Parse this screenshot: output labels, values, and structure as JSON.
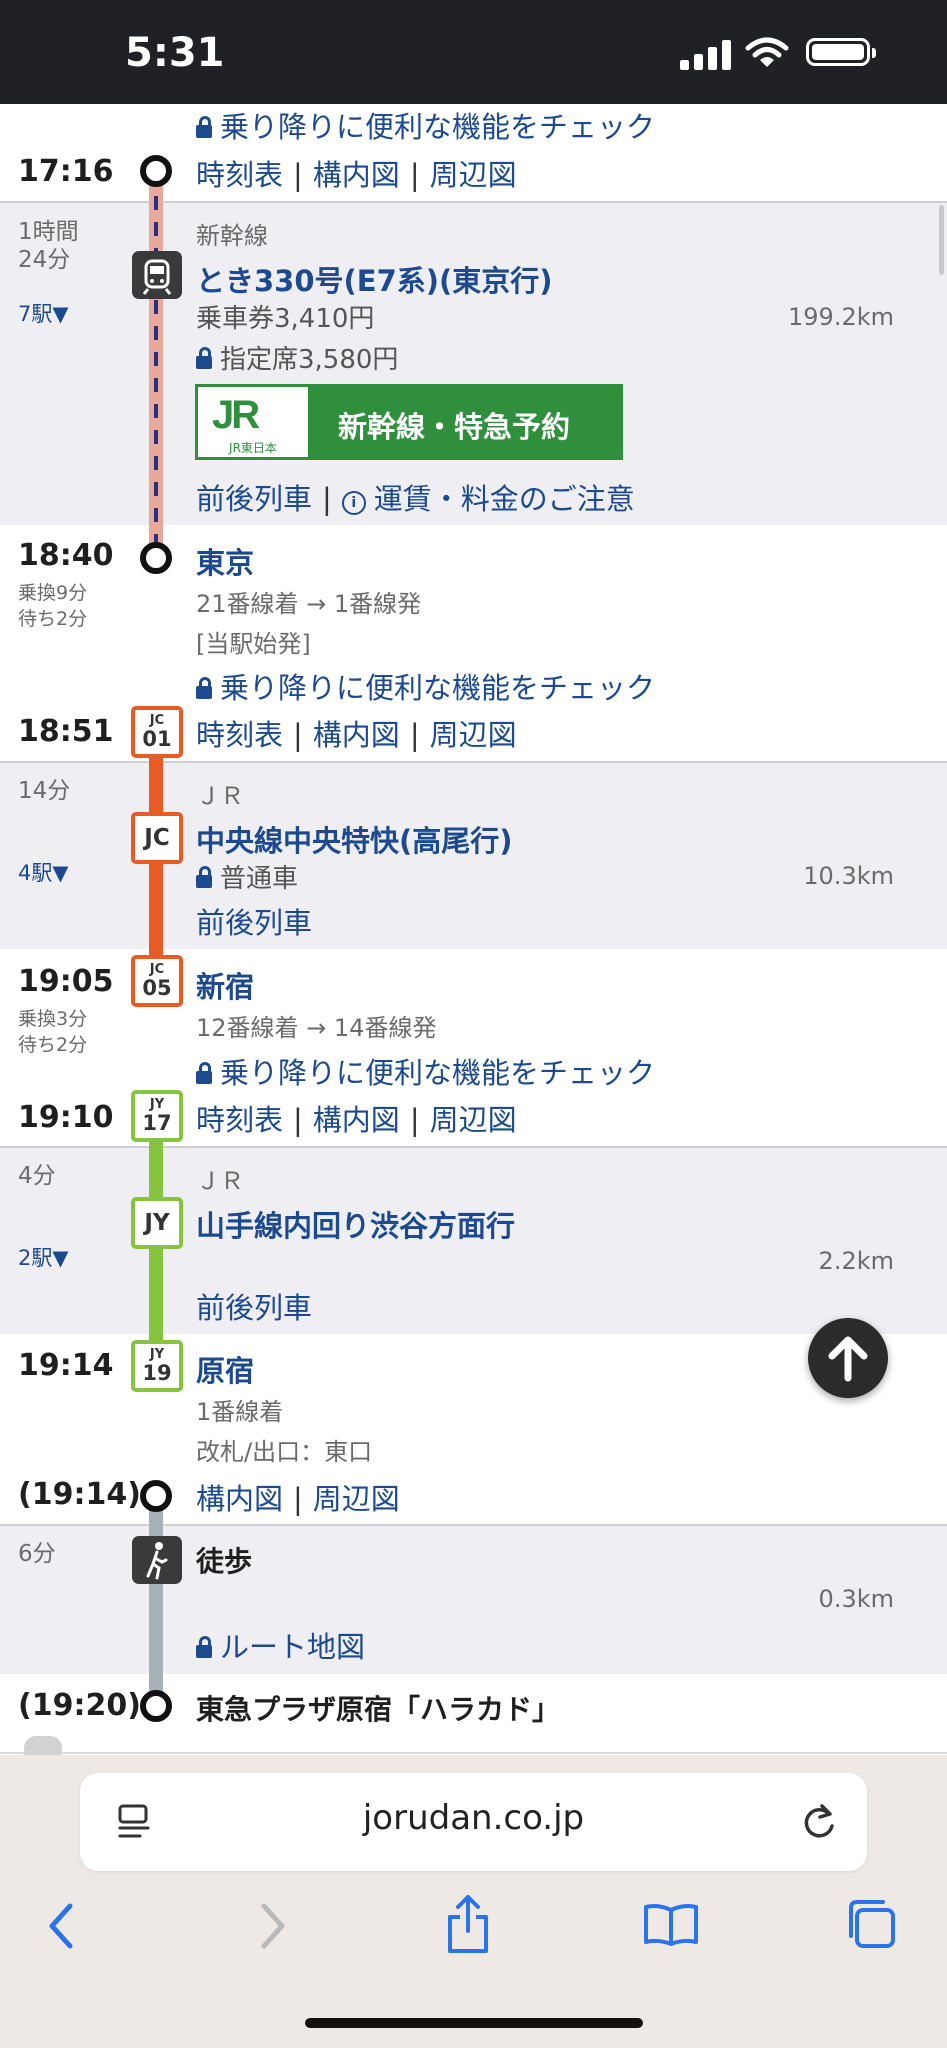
{
  "status": {
    "time": "5:31"
  },
  "labels": {
    "check_features": "乗り降りに便利な機能をチェック",
    "timetable": "時刻表",
    "station_map": "構内図",
    "area_map": "周辺図",
    "nearby_trains": "前後列車",
    "fare_notice": "運賃・料金のご注意",
    "jr_banner_logo": "JR東日本",
    "jr_banner_text": "新幹線・特急予約"
  },
  "top": {
    "time": "17:16"
  },
  "seg1": {
    "duration": "1時間\n24分",
    "stops": "7駅▼",
    "category": "新幹線",
    "train": "とき330号(E7系)(東京行)",
    "fare": "乗車券3,410円",
    "reserved": "指定席3,580円",
    "distance": "199.2km"
  },
  "tokyo": {
    "arr_time": "18:40",
    "transfer": "乗換9分\n待ち2分",
    "name": "東京",
    "platform": "21番線着 → 1番線発",
    "note": "[当駅始発]",
    "dep_time": "18:51",
    "badge_top": "JC",
    "badge_num": "01"
  },
  "seg2": {
    "duration": "14分",
    "stops": "4駅▼",
    "category": "ＪＲ",
    "train": "中央線中央特快(高尾行)",
    "seat": "普通車",
    "distance": "10.3km",
    "badge": "JC"
  },
  "shinjuku": {
    "arr_time": "19:05",
    "transfer": "乗換3分\n待ち2分",
    "name": "新宿",
    "platform": "12番線着 → 14番線発",
    "dep_time": "19:10",
    "arr_badge_top": "JC",
    "arr_badge_num": "05",
    "dep_badge_top": "JY",
    "dep_badge_num": "17"
  },
  "seg3": {
    "duration": "4分",
    "stops": "2駅▼",
    "category": "ＪＲ",
    "train": "山手線内回り渋谷方面行",
    "distance": "2.2km",
    "badge": "JY"
  },
  "harajuku": {
    "arr_time": "19:14",
    "name": "原宿",
    "platform": "1番線着",
    "exit": "改札/出口：東口",
    "dep_time": "(19:14)",
    "badge_top": "JY",
    "badge_num": "19"
  },
  "walk": {
    "duration": "6分",
    "label": "徒歩",
    "distance": "0.3km",
    "route_map": "ルート地図"
  },
  "dest": {
    "time": "(19:20)",
    "name": "東急プラザ原宿「ハラカド」"
  },
  "browser": {
    "url": "jorudan.co.jp"
  },
  "colors": {
    "shinkansen": "#e9a89c",
    "chuo": "#e65c24",
    "yamanote": "#86c440",
    "walk": "#a7b1b8",
    "link": "#1d4a8f"
  }
}
